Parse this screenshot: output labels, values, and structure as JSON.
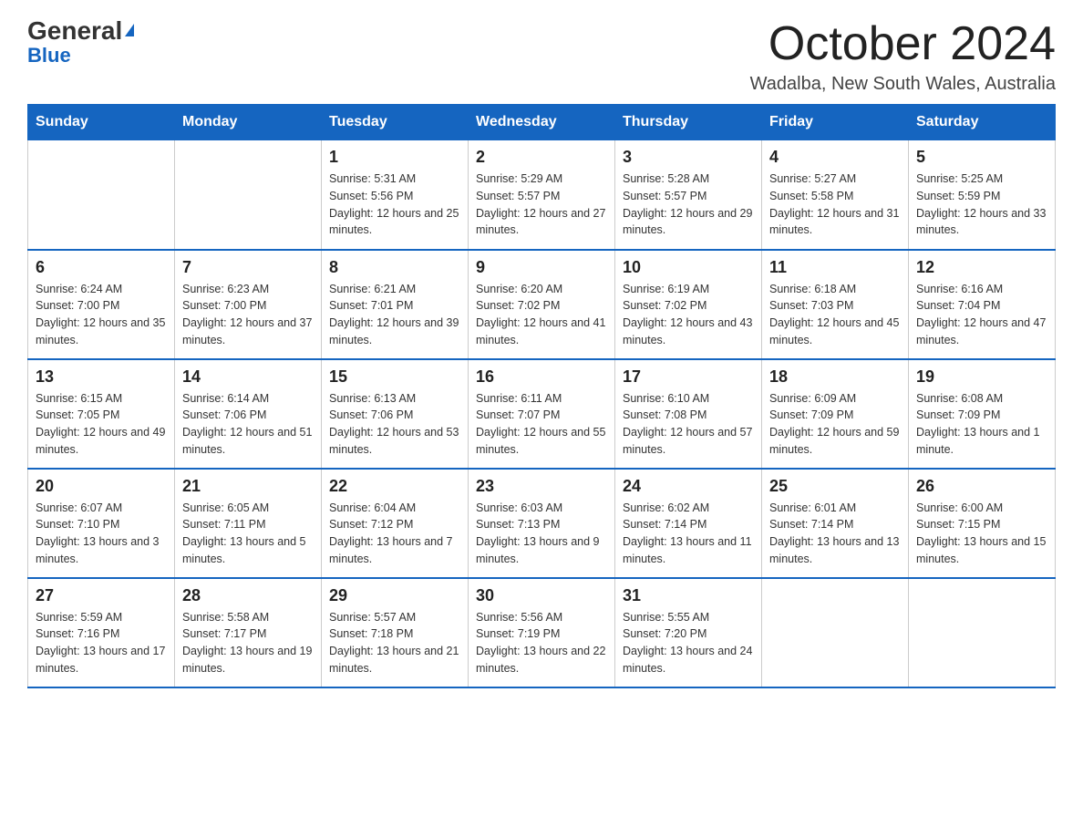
{
  "logo": {
    "general": "General",
    "blue": "Blue",
    "triangle": "▲"
  },
  "title": "October 2024",
  "location": "Wadalba, New South Wales, Australia",
  "headers": [
    "Sunday",
    "Monday",
    "Tuesday",
    "Wednesday",
    "Thursday",
    "Friday",
    "Saturday"
  ],
  "weeks": [
    [
      {
        "day": "",
        "sunrise": "",
        "sunset": "",
        "daylight": ""
      },
      {
        "day": "",
        "sunrise": "",
        "sunset": "",
        "daylight": ""
      },
      {
        "day": "1",
        "sunrise": "Sunrise: 5:31 AM",
        "sunset": "Sunset: 5:56 PM",
        "daylight": "Daylight: 12 hours and 25 minutes."
      },
      {
        "day": "2",
        "sunrise": "Sunrise: 5:29 AM",
        "sunset": "Sunset: 5:57 PM",
        "daylight": "Daylight: 12 hours and 27 minutes."
      },
      {
        "day": "3",
        "sunrise": "Sunrise: 5:28 AM",
        "sunset": "Sunset: 5:57 PM",
        "daylight": "Daylight: 12 hours and 29 minutes."
      },
      {
        "day": "4",
        "sunrise": "Sunrise: 5:27 AM",
        "sunset": "Sunset: 5:58 PM",
        "daylight": "Daylight: 12 hours and 31 minutes."
      },
      {
        "day": "5",
        "sunrise": "Sunrise: 5:25 AM",
        "sunset": "Sunset: 5:59 PM",
        "daylight": "Daylight: 12 hours and 33 minutes."
      }
    ],
    [
      {
        "day": "6",
        "sunrise": "Sunrise: 6:24 AM",
        "sunset": "Sunset: 7:00 PM",
        "daylight": "Daylight: 12 hours and 35 minutes."
      },
      {
        "day": "7",
        "sunrise": "Sunrise: 6:23 AM",
        "sunset": "Sunset: 7:00 PM",
        "daylight": "Daylight: 12 hours and 37 minutes."
      },
      {
        "day": "8",
        "sunrise": "Sunrise: 6:21 AM",
        "sunset": "Sunset: 7:01 PM",
        "daylight": "Daylight: 12 hours and 39 minutes."
      },
      {
        "day": "9",
        "sunrise": "Sunrise: 6:20 AM",
        "sunset": "Sunset: 7:02 PM",
        "daylight": "Daylight: 12 hours and 41 minutes."
      },
      {
        "day": "10",
        "sunrise": "Sunrise: 6:19 AM",
        "sunset": "Sunset: 7:02 PM",
        "daylight": "Daylight: 12 hours and 43 minutes."
      },
      {
        "day": "11",
        "sunrise": "Sunrise: 6:18 AM",
        "sunset": "Sunset: 7:03 PM",
        "daylight": "Daylight: 12 hours and 45 minutes."
      },
      {
        "day": "12",
        "sunrise": "Sunrise: 6:16 AM",
        "sunset": "Sunset: 7:04 PM",
        "daylight": "Daylight: 12 hours and 47 minutes."
      }
    ],
    [
      {
        "day": "13",
        "sunrise": "Sunrise: 6:15 AM",
        "sunset": "Sunset: 7:05 PM",
        "daylight": "Daylight: 12 hours and 49 minutes."
      },
      {
        "day": "14",
        "sunrise": "Sunrise: 6:14 AM",
        "sunset": "Sunset: 7:06 PM",
        "daylight": "Daylight: 12 hours and 51 minutes."
      },
      {
        "day": "15",
        "sunrise": "Sunrise: 6:13 AM",
        "sunset": "Sunset: 7:06 PM",
        "daylight": "Daylight: 12 hours and 53 minutes."
      },
      {
        "day": "16",
        "sunrise": "Sunrise: 6:11 AM",
        "sunset": "Sunset: 7:07 PM",
        "daylight": "Daylight: 12 hours and 55 minutes."
      },
      {
        "day": "17",
        "sunrise": "Sunrise: 6:10 AM",
        "sunset": "Sunset: 7:08 PM",
        "daylight": "Daylight: 12 hours and 57 minutes."
      },
      {
        "day": "18",
        "sunrise": "Sunrise: 6:09 AM",
        "sunset": "Sunset: 7:09 PM",
        "daylight": "Daylight: 12 hours and 59 minutes."
      },
      {
        "day": "19",
        "sunrise": "Sunrise: 6:08 AM",
        "sunset": "Sunset: 7:09 PM",
        "daylight": "Daylight: 13 hours and 1 minute."
      }
    ],
    [
      {
        "day": "20",
        "sunrise": "Sunrise: 6:07 AM",
        "sunset": "Sunset: 7:10 PM",
        "daylight": "Daylight: 13 hours and 3 minutes."
      },
      {
        "day": "21",
        "sunrise": "Sunrise: 6:05 AM",
        "sunset": "Sunset: 7:11 PM",
        "daylight": "Daylight: 13 hours and 5 minutes."
      },
      {
        "day": "22",
        "sunrise": "Sunrise: 6:04 AM",
        "sunset": "Sunset: 7:12 PM",
        "daylight": "Daylight: 13 hours and 7 minutes."
      },
      {
        "day": "23",
        "sunrise": "Sunrise: 6:03 AM",
        "sunset": "Sunset: 7:13 PM",
        "daylight": "Daylight: 13 hours and 9 minutes."
      },
      {
        "day": "24",
        "sunrise": "Sunrise: 6:02 AM",
        "sunset": "Sunset: 7:14 PM",
        "daylight": "Daylight: 13 hours and 11 minutes."
      },
      {
        "day": "25",
        "sunrise": "Sunrise: 6:01 AM",
        "sunset": "Sunset: 7:14 PM",
        "daylight": "Daylight: 13 hours and 13 minutes."
      },
      {
        "day": "26",
        "sunrise": "Sunrise: 6:00 AM",
        "sunset": "Sunset: 7:15 PM",
        "daylight": "Daylight: 13 hours and 15 minutes."
      }
    ],
    [
      {
        "day": "27",
        "sunrise": "Sunrise: 5:59 AM",
        "sunset": "Sunset: 7:16 PM",
        "daylight": "Daylight: 13 hours and 17 minutes."
      },
      {
        "day": "28",
        "sunrise": "Sunrise: 5:58 AM",
        "sunset": "Sunset: 7:17 PM",
        "daylight": "Daylight: 13 hours and 19 minutes."
      },
      {
        "day": "29",
        "sunrise": "Sunrise: 5:57 AM",
        "sunset": "Sunset: 7:18 PM",
        "daylight": "Daylight: 13 hours and 21 minutes."
      },
      {
        "day": "30",
        "sunrise": "Sunrise: 5:56 AM",
        "sunset": "Sunset: 7:19 PM",
        "daylight": "Daylight: 13 hours and 22 minutes."
      },
      {
        "day": "31",
        "sunrise": "Sunrise: 5:55 AM",
        "sunset": "Sunset: 7:20 PM",
        "daylight": "Daylight: 13 hours and 24 minutes."
      },
      {
        "day": "",
        "sunrise": "",
        "sunset": "",
        "daylight": ""
      },
      {
        "day": "",
        "sunrise": "",
        "sunset": "",
        "daylight": ""
      }
    ]
  ]
}
